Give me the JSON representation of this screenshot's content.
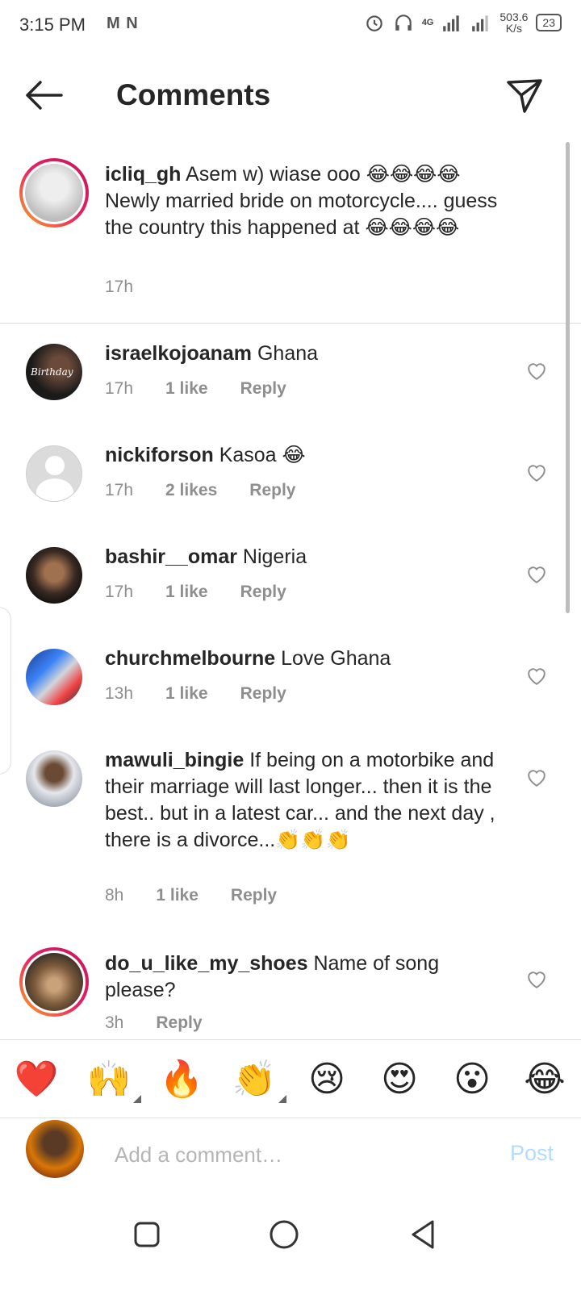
{
  "status_bar": {
    "time": "3:15 PM",
    "notif_icons": "M N",
    "network": "4G",
    "speed_value": "503.6",
    "speed_unit": "K/s",
    "battery": "23"
  },
  "header": {
    "title": "Comments"
  },
  "caption": {
    "username": "icliq_gh",
    "text": " Asem w) wiase ooo 😂😂😂😂 Newly married bride on motorcycle.... guess the country this happened at 😂😂😂😂",
    "time": "17h"
  },
  "comments": [
    {
      "username": "israelkojoanam",
      "text": " Ghana",
      "time": "17h",
      "likes": "1 like",
      "reply": "Reply",
      "avatar_label": "Birthday"
    },
    {
      "username": "nickiforson",
      "text": " Kasoa 😂",
      "time": "17h",
      "likes": "2 likes",
      "reply": "Reply"
    },
    {
      "username": "bashir__omar",
      "text": " Nigeria",
      "time": "17h",
      "likes": "1 like",
      "reply": "Reply"
    },
    {
      "username": "churchmelbourne",
      "text": " Love Ghana",
      "time": "13h",
      "likes": "1 like",
      "reply": "Reply"
    },
    {
      "username": "mawuli_bingie",
      "text": " If being on a motorbike and their marriage will last longer... then it is the best.. but in a latest car... and the next day , there is a divorce...👏👏👏",
      "time": "8h",
      "likes": "1 like",
      "reply": "Reply"
    },
    {
      "username": "do_u_like_my_shoes",
      "text": " Name of song please?",
      "time": "3h",
      "reply": "Reply"
    }
  ],
  "emoji_bar": [
    "❤️",
    "🙌",
    "🔥",
    "👏",
    "😢",
    "😍",
    "😮",
    "😂"
  ],
  "input": {
    "placeholder": "Add a comment…",
    "post_label": "Post"
  },
  "colors": {
    "accent_post": "#b3dbff",
    "meta_gray": "#8e8e8e",
    "heart": "#e0245e"
  }
}
